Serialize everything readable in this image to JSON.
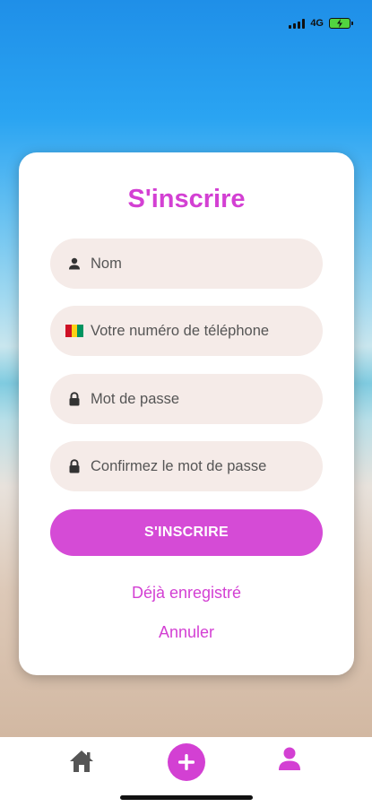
{
  "status_bar": {
    "network": "4G"
  },
  "form": {
    "title": "S'inscrire",
    "fields": [
      {
        "name": "name",
        "icon": "person-icon",
        "placeholder": "Nom"
      },
      {
        "name": "phone",
        "icon": "guinea-flag-icon",
        "placeholder": "Votre numéro de téléphone"
      },
      {
        "name": "password",
        "icon": "lock-icon",
        "placeholder": "Mot de passe"
      },
      {
        "name": "confirm_password",
        "icon": "lock-icon",
        "placeholder": "Confirmez le mot de passe"
      }
    ],
    "submit_label": "S'INSCRIRE",
    "already_registered_label": "Déjà enregistré",
    "cancel_label": "Annuler"
  },
  "tab_bar": {
    "items": [
      {
        "name": "home",
        "icon": "home-icon"
      },
      {
        "name": "add",
        "icon": "plus-circle-icon"
      },
      {
        "name": "profile",
        "icon": "person-icon"
      }
    ]
  },
  "colors": {
    "accent": "#d340d3",
    "button": "#d54bd6",
    "field_bg": "#f5ebe8",
    "tab_icon_inactive": "#555555"
  }
}
